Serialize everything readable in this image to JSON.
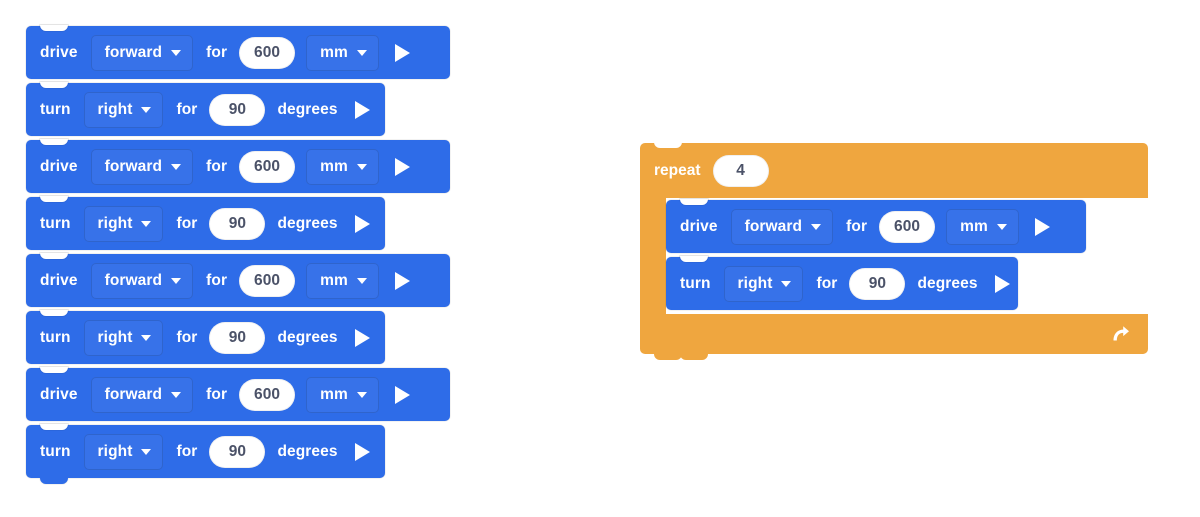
{
  "colors": {
    "motion_blue": "#2e6ce8",
    "control_orange": "#efa63f",
    "field_text": "#4b5268",
    "block_text": "#ffffff",
    "canvas": "#ffffff"
  },
  "icons": {
    "caret": "chevron-down-icon",
    "play": "play-icon",
    "loop": "loop-arrow-icon"
  },
  "left_stack": {
    "name": "unrolled-square-program",
    "blocks": [
      {
        "kind": "drive",
        "label": "drive",
        "direction": "forward",
        "for": "for",
        "value": "600",
        "unit": "mm"
      },
      {
        "kind": "turn",
        "label": "turn",
        "direction": "right",
        "for": "for",
        "value": "90",
        "unit": "degrees"
      },
      {
        "kind": "drive",
        "label": "drive",
        "direction": "forward",
        "for": "for",
        "value": "600",
        "unit": "mm"
      },
      {
        "kind": "turn",
        "label": "turn",
        "direction": "right",
        "for": "for",
        "value": "90",
        "unit": "degrees"
      },
      {
        "kind": "drive",
        "label": "drive",
        "direction": "forward",
        "for": "for",
        "value": "600",
        "unit": "mm"
      },
      {
        "kind": "turn",
        "label": "turn",
        "direction": "right",
        "for": "for",
        "value": "90",
        "unit": "degrees"
      },
      {
        "kind": "drive",
        "label": "drive",
        "direction": "forward",
        "for": "for",
        "value": "600",
        "unit": "mm"
      },
      {
        "kind": "turn",
        "label": "turn",
        "direction": "right",
        "for": "for",
        "value": "90",
        "unit": "degrees"
      }
    ]
  },
  "right_stack": {
    "name": "repeat-loop-program",
    "repeat": {
      "label": "repeat",
      "count": "4"
    },
    "blocks": [
      {
        "kind": "drive",
        "label": "drive",
        "direction": "forward",
        "for": "for",
        "value": "600",
        "unit": "mm"
      },
      {
        "kind": "turn",
        "label": "turn",
        "direction": "right",
        "for": "for",
        "value": "90",
        "unit": "degrees"
      }
    ]
  }
}
